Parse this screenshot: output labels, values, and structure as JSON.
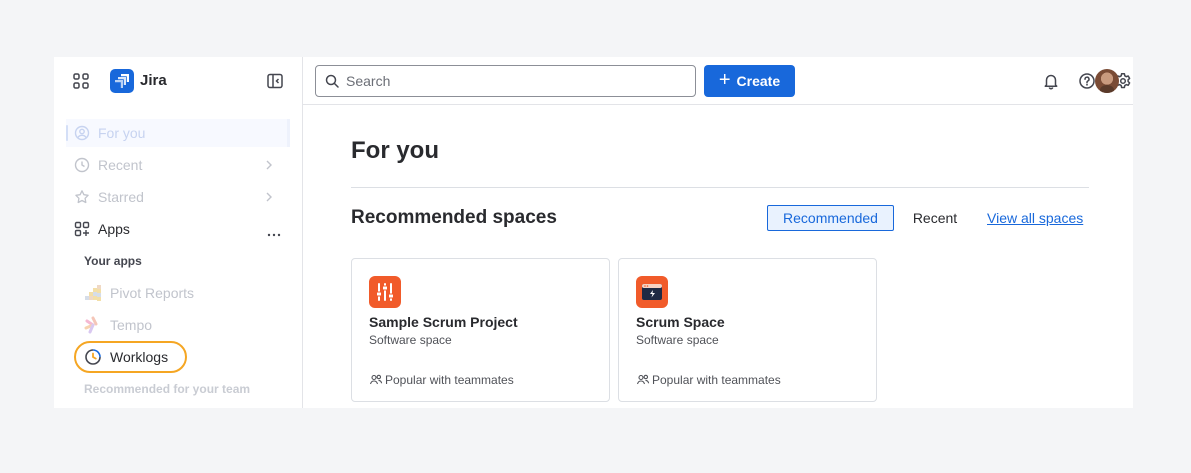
{
  "app": {
    "name": "Jira"
  },
  "sidebar": {
    "items": [
      {
        "label": "For you",
        "selected": true
      },
      {
        "label": "Recent"
      },
      {
        "label": "Starred"
      },
      {
        "label": "Apps"
      }
    ],
    "your_apps_heading": "Your apps",
    "apps": [
      {
        "label": "Pivot Reports"
      },
      {
        "label": "Tempo"
      },
      {
        "label": "Worklogs"
      }
    ],
    "recommended_heading": "Recommended for your team"
  },
  "topbar": {
    "search_placeholder": "Search",
    "create_label": "Create"
  },
  "main": {
    "title": "For you",
    "section_title": "Recommended spaces",
    "tabs": [
      {
        "label": "Recommended",
        "active": true
      },
      {
        "label": "Recent"
      }
    ],
    "view_all_label": "View all spaces",
    "cards": [
      {
        "title": "Sample Scrum Project",
        "subtitle": "Software space",
        "footer": "Popular with teammates",
        "icon": "sliders-icon"
      },
      {
        "title": "Scrum Space",
        "subtitle": "Software space",
        "footer": "Popular with teammates",
        "icon": "terminal-bolt-icon"
      }
    ]
  },
  "colors": {
    "brand_blue": "#1868db",
    "highlight_orange": "#f5a623",
    "card_icon_orange": "#f15b2a"
  }
}
